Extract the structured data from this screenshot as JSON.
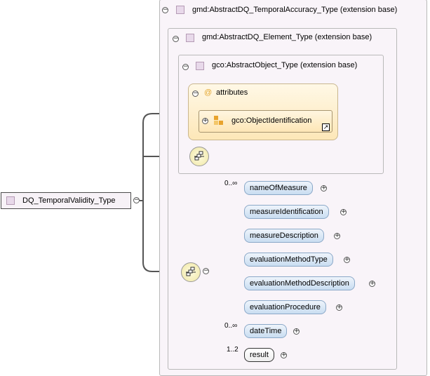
{
  "root": {
    "label": "DQ_TemporalValidity_Type"
  },
  "extensions": [
    {
      "label": "gmd:AbstractDQ_TemporalAccuracy_Type (extension base)"
    },
    {
      "label": "gmd:AbstractDQ_Element_Type (extension base)"
    },
    {
      "label": "gco:AbstractObject_Type (extension base)"
    }
  ],
  "attributes": {
    "label": "attributes",
    "group": {
      "label": "gco:ObjectIdentification"
    }
  },
  "elements": [
    {
      "label": "nameOfMeasure",
      "occurrence": "0..∞"
    },
    {
      "label": "measureIdentification",
      "occurrence": ""
    },
    {
      "label": "measureDescription",
      "occurrence": ""
    },
    {
      "label": "evaluationMethodType",
      "occurrence": ""
    },
    {
      "label": "evaluationMethodDescription",
      "occurrence": ""
    },
    {
      "label": "evaluationProcedure",
      "occurrence": ""
    },
    {
      "label": "dateTime",
      "occurrence": "0..∞"
    },
    {
      "label": "result",
      "occurrence": "1..2"
    }
  ],
  "icons": {
    "toggle_collapse": "minus-circle",
    "toggle_expand": "plus-circle",
    "complex_type": "square-lilac",
    "attribute": "at-sign",
    "attribute_group": "squares-orange",
    "reference": "arrow-link",
    "sequence": "sequence-compositor"
  },
  "colors": {
    "element_fill": "#c9ddf1",
    "attributes_fill": "#fde7b8",
    "extension_fill": "#f9f4f9"
  }
}
